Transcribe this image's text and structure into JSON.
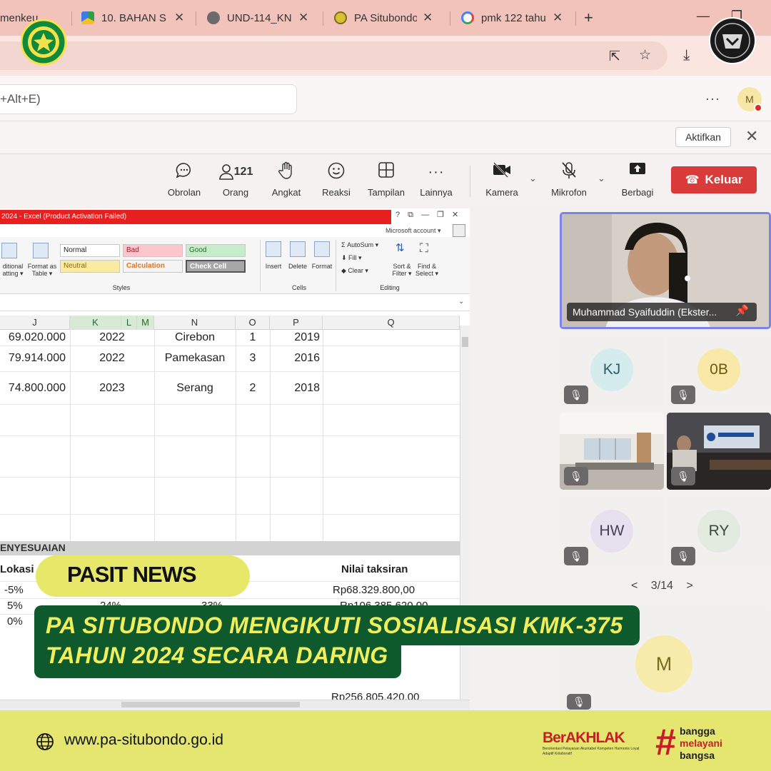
{
  "browser": {
    "tabs": [
      {
        "label": "menkeu",
        "close": ""
      },
      {
        "label": "10. BAHAN S",
        "close": "✕"
      },
      {
        "label": "UND-114_KN",
        "close": "✕"
      },
      {
        "label": "PA Situbondo",
        "close": "✕"
      },
      {
        "label": "pmk 122 tahu",
        "close": "✕"
      }
    ],
    "new_tab": "+",
    "window_controls": [
      "—",
      "❐"
    ],
    "omnibox_icons": [
      "⇱",
      "☆",
      "⤓"
    ]
  },
  "teams": {
    "search_placeholder": "+Alt+E)",
    "more": "···",
    "avatar_initial": "M",
    "notification": {
      "button": "Aktifkan",
      "close": "✕"
    },
    "controls": [
      {
        "id": "chat",
        "label": "Obrolan",
        "icon": "chat-icon",
        "glyph": "💬"
      },
      {
        "id": "people",
        "label": "Orang",
        "icon": "people-icon",
        "glyph": "👤",
        "count": "121"
      },
      {
        "id": "raise",
        "label": "Angkat",
        "icon": "raise-hand-icon",
        "glyph": "✋"
      },
      {
        "id": "react",
        "label": "Reaksi",
        "icon": "smiley-icon",
        "glyph": "☺"
      },
      {
        "id": "view",
        "label": "Tampilan",
        "icon": "grid-icon",
        "glyph": "⊞"
      },
      {
        "id": "more",
        "label": "Lainnya",
        "icon": "more-icon",
        "glyph": "···"
      },
      {
        "id": "camera",
        "label": "Kamera",
        "icon": "camera-off-icon",
        "glyph": "■"
      },
      {
        "id": "mic",
        "label": "Mikrofon",
        "icon": "mic-off-icon",
        "glyph": "🎙"
      },
      {
        "id": "share",
        "label": "Berbagi",
        "icon": "share-icon",
        "glyph": "⬆"
      }
    ],
    "leave_label": "Keluar",
    "leave_icon": "☎",
    "speaker_name": "Muhammad Syaifuddin (Ekster...",
    "participants": [
      {
        "initials": "KJ",
        "bg": "#d5ecef",
        "fg": "#2d5f66"
      },
      {
        "initials": "0B",
        "bg": "#f8e9a8",
        "fg": "#6d5a12"
      },
      {
        "initials": "HW",
        "bg": "#e7e1ef",
        "fg": "#463f56"
      },
      {
        "initials": "RY",
        "bg": "#e3eae0",
        "fg": "#3b4a36"
      },
      {
        "initials": "M",
        "bg": "#f7ebab",
        "fg": "#7a6a22"
      }
    ],
    "pager": {
      "prev": "<",
      "label": "3/14",
      "next": ">"
    }
  },
  "excel": {
    "title": "2024 - Excel (Product Activation Failed)",
    "window_buttons": "?  ⧉  —  ❐  ✕",
    "account": "Microsoft account ▾",
    "ribbon": {
      "cond_format": "ditional\natting ▾",
      "format_table": "Format as\nTable ▾",
      "styles": {
        "normal": "Normal",
        "bad": "Bad",
        "good": "Good",
        "neutral": "Neutral",
        "calculation": "Calculation",
        "check_cell": "Check Cell"
      },
      "styles_group": "Styles",
      "insert": "Insert",
      "delete": "Delete",
      "format": "Format",
      "cells_group": "Cells",
      "autosum": "Σ AutoSum ▾",
      "fill": "⬇ Fill ▾",
      "clear": "◆ Clear ▾",
      "sort_filter": "Sort &\nFilter ▾",
      "find_select": "Find &\nSelect ▾",
      "editing_group": "Editing"
    },
    "columns": [
      "J",
      "K",
      "L",
      "M",
      "N",
      "O",
      "P",
      "Q"
    ],
    "rows": [
      {
        "j": "69.020.000",
        "k": "2022",
        "n": "Cirebon",
        "o": "1",
        "p": "2019"
      },
      {
        "j": "79.914.000",
        "k": "2022",
        "n": "Pamekasan",
        "o": "3",
        "p": "2016"
      },
      {
        "j": "74.800.000",
        "k": "2023",
        "n": "Serang",
        "o": "2",
        "p": "2018"
      }
    ],
    "section_title": "ENYESUAIAN",
    "lokasi_header": "Lokasi",
    "nilai_header": "Nilai taksiran",
    "lokasi_values": [
      "-5%",
      "5%",
      "0%"
    ],
    "mid_values": [
      "24%",
      "33%"
    ],
    "nilai_values": [
      "Rp68.329.800,00",
      "Rp106.385.620,00"
    ],
    "bottom_value": "Rp256.805.420,00"
  },
  "overlay": {
    "badge": "PASIT NEWS",
    "headline_line1": "PA SITUBONDO MENGIKUTI SOSIALISASI KMK-375",
    "headline_line2": "TAHUN 2024 SECARA DARING"
  },
  "footer": {
    "website": "www.pa-situbondo.go.id",
    "berakhlak": "BerAKHLAK",
    "berakhlak_sub": "Berorientasi Pelayanan Akuntabel Kompeten Harmonis Loyal Adaptif Kolaboratif",
    "hash": "#",
    "bangga": "bangga",
    "melayani": "melayani",
    "bangsa": "bangsa"
  },
  "colors": {
    "accent_green": "#0e5a2c",
    "accent_yellow": "#e5e670",
    "headline_text": "#f1ee5d",
    "leave_red": "#d93b3b",
    "excel_red": "#e81f1f"
  }
}
